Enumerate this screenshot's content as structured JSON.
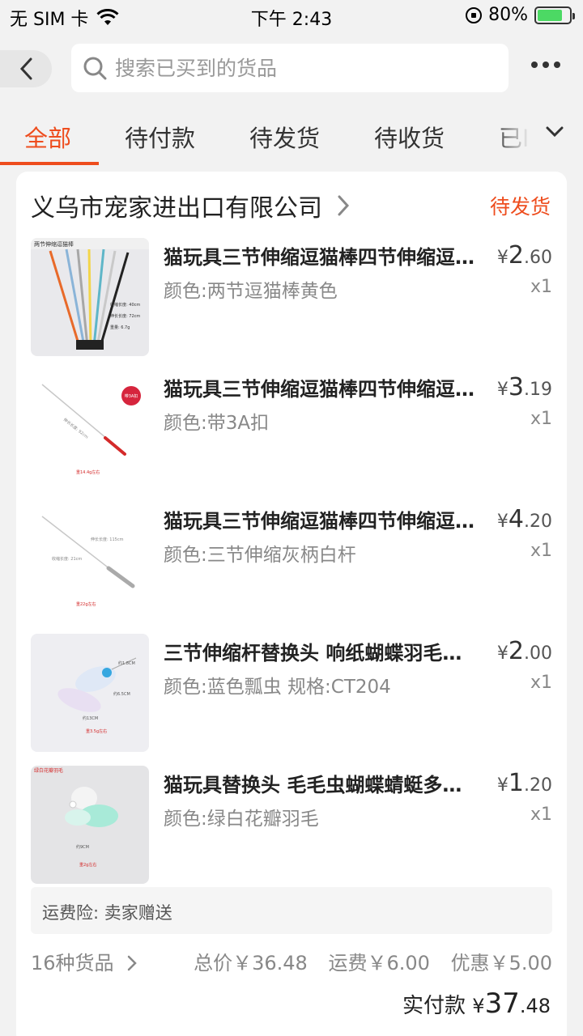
{
  "status_bar": {
    "carrier": "无 SIM 卡",
    "time": "下午 2:43",
    "battery": "80%",
    "battery_level": 0.8
  },
  "search": {
    "placeholder": "搜索已买到的货品"
  },
  "tabs": [
    {
      "label": "全部",
      "active": true
    },
    {
      "label": "待付款"
    },
    {
      "label": "待发货"
    },
    {
      "label": "待收货"
    },
    {
      "label": "已I"
    }
  ],
  "order": {
    "shop_name": "义乌市宠家进出口有限公司",
    "status": "待发货",
    "items": [
      {
        "title": "猫玩具三节伸缩逗猫棒四节伸缩逗猫棒",
        "spec": "颜色:两节逗猫棒黄色",
        "currency": "¥",
        "price_int": "2",
        "price_dec": ".60",
        "qty": "x1"
      },
      {
        "title": "猫玩具三节伸缩逗猫棒四节伸缩逗猫棒",
        "spec": "颜色:带3A扣",
        "currency": "¥",
        "price_int": "3",
        "price_dec": ".19",
        "qty": "x1"
      },
      {
        "title": "猫玩具三节伸缩逗猫棒四节伸缩逗猫棒",
        "spec": "颜色:三节伸缩灰柄白杆",
        "currency": "¥",
        "price_int": "4",
        "price_dec": ".20",
        "qty": "x1"
      },
      {
        "title": "三节伸缩杆替换头 响纸蝴蝶羽毛替换头",
        "spec": "颜色:蓝色瓢虫 规格:CT204",
        "currency": "¥",
        "price_int": "2",
        "price_dec": ".00",
        "qty": "x1"
      },
      {
        "title": "猫玩具替换头 毛毛虫蝴蝶蜻蜓多款替换头",
        "spec": "颜色:绿白花瓣羽毛",
        "currency": "¥",
        "price_int": "1",
        "price_dec": ".20",
        "qty": "x1"
      }
    ],
    "insurance": "运费险:  卖家赠送",
    "count_label": "16种货品",
    "total": "总价￥36.48",
    "shipping": "运费￥6.00",
    "discount": "优惠￥5.00",
    "paid_label": "实付款",
    "paid_currency": "¥",
    "paid_int": "37",
    "paid_dec": ".48"
  },
  "thumb_labels": {
    "t1": "两节伸缩逗猫棒",
    "t1_spec1": "收缩长度: 40cm",
    "t1_spec2": "伸长长度: 72cm",
    "t1_spec3": "重量: 6.7g",
    "t2_badge": "带3A扣",
    "t2_length": "伸长长度: 92cm",
    "t2_weight": "重14.4g左右",
    "t3_len1": "伸长长度: 115cm",
    "t3_len2": "收缩长度: 21cm",
    "t3_weight": "重22g左右",
    "t4_a": "约1.8CM",
    "t4_b": "约6.5CM",
    "t4_c": "约13CM",
    "t4_weight": "重3.5g左右",
    "t5_label": "绿白花瓣羽毛",
    "t5_size": "约9CM",
    "t5_weight": "重2g左右"
  }
}
